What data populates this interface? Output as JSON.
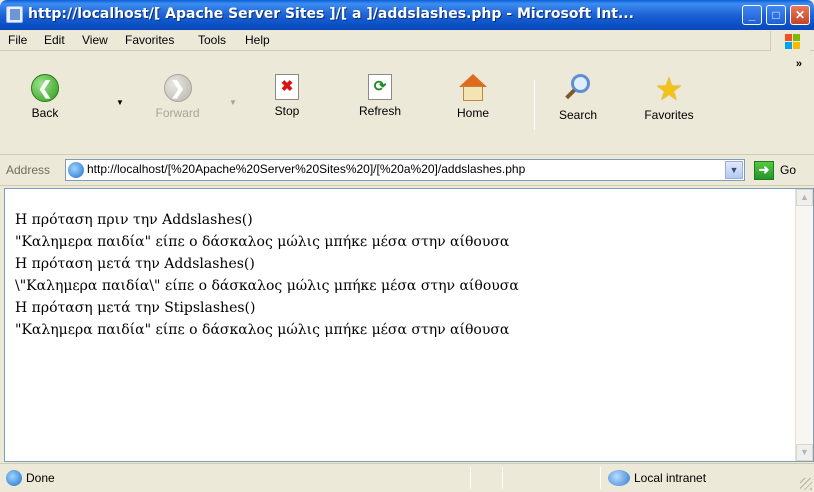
{
  "window": {
    "title": "http://localhost/[ Apache Server Sites ]/[ a ]/addslashes.php - Microsoft Int..."
  },
  "menu": {
    "items": [
      "File",
      "Edit",
      "View",
      "Favorites",
      "Tools",
      "Help"
    ]
  },
  "toolbar": {
    "back_label": "Back",
    "forward_label": "Forward",
    "stop_label": "Stop",
    "refresh_label": "Refresh",
    "home_label": "Home",
    "search_label": "Search",
    "favorites_label": "Favorites",
    "more": "»"
  },
  "address": {
    "label": "Address",
    "url": "http://localhost/[%20Apache%20Server%20Sites%20]/[%20a%20]/addslashes.php",
    "go_label": "Go"
  },
  "content": {
    "lines": [
      "Η πρόταση πριν την Addslashes()",
      "\"Καλημερα παιδία\" είπε ο δάσκαλος μώλις μπήκε μέσα στην αίθουσα",
      "Η πρόταση μετά την Addslashes()",
      "\\\"Καλημερα παιδία\\\" είπε ο δάσκαλος μώλις μπήκε μέσα στην αίθουσα",
      "Η πρόταση μετά την Stipslashes()",
      "\"Καλημερα παιδία\" είπε ο δάσκαλος μώλις μπήκε μέσα στην αίθουσα"
    ]
  },
  "status": {
    "text": "Done",
    "zone": "Local intranet"
  },
  "colors": {
    "titlebar": "#0a4fc2",
    "chrome": "#ece9d8",
    "go_green": "#23952a"
  },
  "icons": {
    "back": "back-arrow-icon",
    "forward": "forward-arrow-icon",
    "stop": "stop-icon",
    "refresh": "refresh-icon",
    "home": "home-icon",
    "search": "search-icon",
    "favorites": "favorites-star-icon"
  }
}
